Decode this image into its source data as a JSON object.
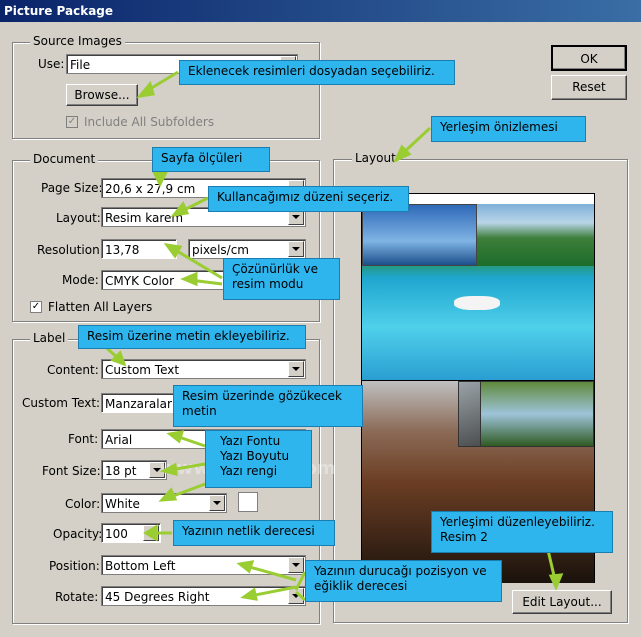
{
  "window": {
    "title": "Picture Package"
  },
  "buttons": {
    "ok": "OK",
    "reset": "Reset",
    "browse": "Browse...",
    "edit_layout": "Edit Layout..."
  },
  "source": {
    "legend": "Source Images",
    "use_label": "Use:",
    "use_value": "File",
    "include_subfolders": "Include All Subfolders"
  },
  "document": {
    "legend": "Document",
    "page_size_label": "Page Size:",
    "page_size_value": "20,6 x 27,9 cm",
    "layout_label": "Layout:",
    "layout_value": "Resim karem",
    "resolution_label": "Resolution:",
    "resolution_value": "13,78",
    "resolution_unit": "pixels/cm",
    "mode_label": "Mode:",
    "mode_value": "CMYK Color",
    "flatten_label": "Flatten All Layers"
  },
  "label_group": {
    "legend": "Label",
    "content_label": "Content:",
    "content_value": "Custom Text",
    "custom_text_label": "Custom Text:",
    "custom_text_value": "Manzaralar",
    "font_label": "Font:",
    "font_value": "Arial",
    "font_size_label": "Font Size:",
    "font_size_value": "18 pt",
    "color_label": "Color:",
    "color_value": "White",
    "opacity_label": "Opacity:",
    "opacity_value": "100",
    "position_label": "Position:",
    "position_value": "Bottom Left",
    "rotate_label": "Rotate:",
    "rotate_value": "45 Degrees Right"
  },
  "layout_preview": {
    "legend": "Layout"
  },
  "watermark": "www.tahlers.com",
  "callouts": {
    "c1": "Eklenecek resimleri dosyadan seçebiliriz.",
    "c2": "Yerleşim önizlemesi",
    "c3": "Sayfa ölçüleri",
    "c4": "Kullancağımız düzeni seçeriz.",
    "c5a": "Çözünürlük ve",
    "c5b": "resim modu",
    "c6": "Resim üzerine metin ekleyebiliriz.",
    "c7a": "Resim üzerinde gözükecek",
    "c7b": "metin",
    "c8a": "Yazı Fontu",
    "c8b": "Yazı Boyutu",
    "c8c": "Yazı rengi",
    "c9": "Yazının netlik derecesi",
    "c10a": "Yerleşimi düzenleyebiliriz.",
    "c10b": "Resim 2",
    "c11a": "Yazının durucağı pozisyon ve",
    "c11b": "eğiklik derecesi"
  },
  "colors": {
    "callout": "#2fb5ee",
    "arrow": "#9acd32",
    "title_bar": "#0a246a",
    "dialog": "#d4d0c8"
  }
}
